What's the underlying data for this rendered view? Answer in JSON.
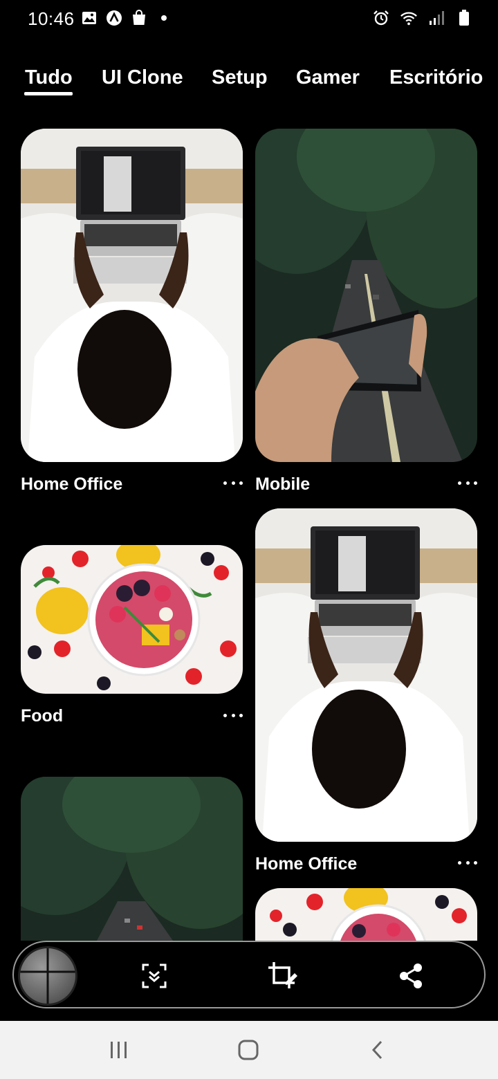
{
  "status_bar": {
    "time": "10:46",
    "left_icons": [
      "gallery-icon",
      "app-a-icon",
      "shopping-bag-icon",
      "dot-icon"
    ],
    "right_icons": [
      "alarm-icon",
      "wifi-icon",
      "signal-icon",
      "battery-icon"
    ]
  },
  "tabs": [
    {
      "label": "Tudo",
      "active": true
    },
    {
      "label": "UI Clone",
      "active": false
    },
    {
      "label": "Setup",
      "active": false
    },
    {
      "label": "Gamer",
      "active": false
    },
    {
      "label": "Escritório",
      "active": false
    }
  ],
  "cards": [
    {
      "title": "Home Office",
      "image": "laptop-top-view"
    },
    {
      "title": "Mobile",
      "image": "phone-forest-road"
    },
    {
      "title": "Food",
      "image": "fruit-bowl"
    },
    {
      "title": "Home Office",
      "image": "laptop-top-view"
    },
    {
      "title": "",
      "image": "forest-road"
    },
    {
      "title": "",
      "image": "fruit-bowl"
    }
  ],
  "toolbar": {
    "buttons": [
      "scroll-capture-icon",
      "crop-edit-icon",
      "share-icon"
    ]
  },
  "nav": {
    "buttons": [
      "recent-apps-icon",
      "home-icon",
      "back-icon"
    ]
  },
  "colors": {
    "background": "#000000",
    "text": "#ffffff",
    "navbar": "#f2f2f2"
  }
}
